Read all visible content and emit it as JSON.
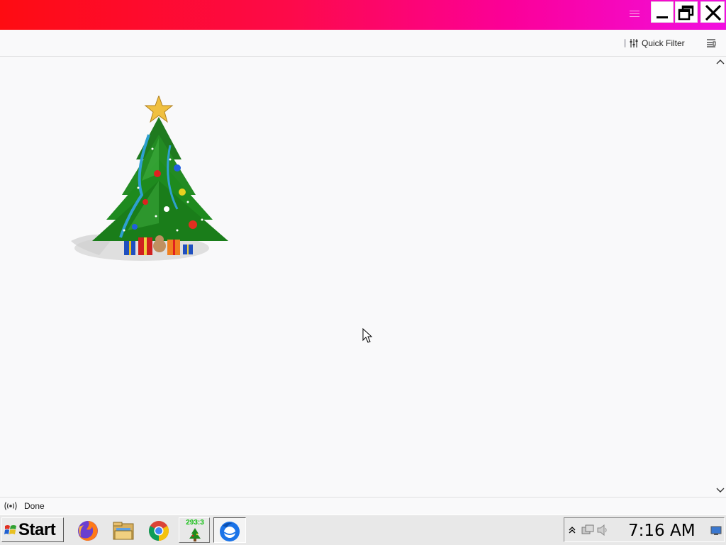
{
  "toolbar": {
    "quick_filter_label": "Quick Filter"
  },
  "statusbar": {
    "status_text": "Done"
  },
  "taskbar": {
    "start_label": "Start",
    "tree_counter": "293:3",
    "clock": "7:16 AM",
    "apps": [
      "firefox-icon",
      "file-manager-icon",
      "chrome-icon",
      "xmas-tree-icon",
      "thunderbird-icon"
    ]
  },
  "colors": {
    "titlebar_start": "#fe0c12",
    "titlebar_end": "#f10fe0",
    "background": "#f9f9fa",
    "taskbar": "#e8e8e8"
  }
}
